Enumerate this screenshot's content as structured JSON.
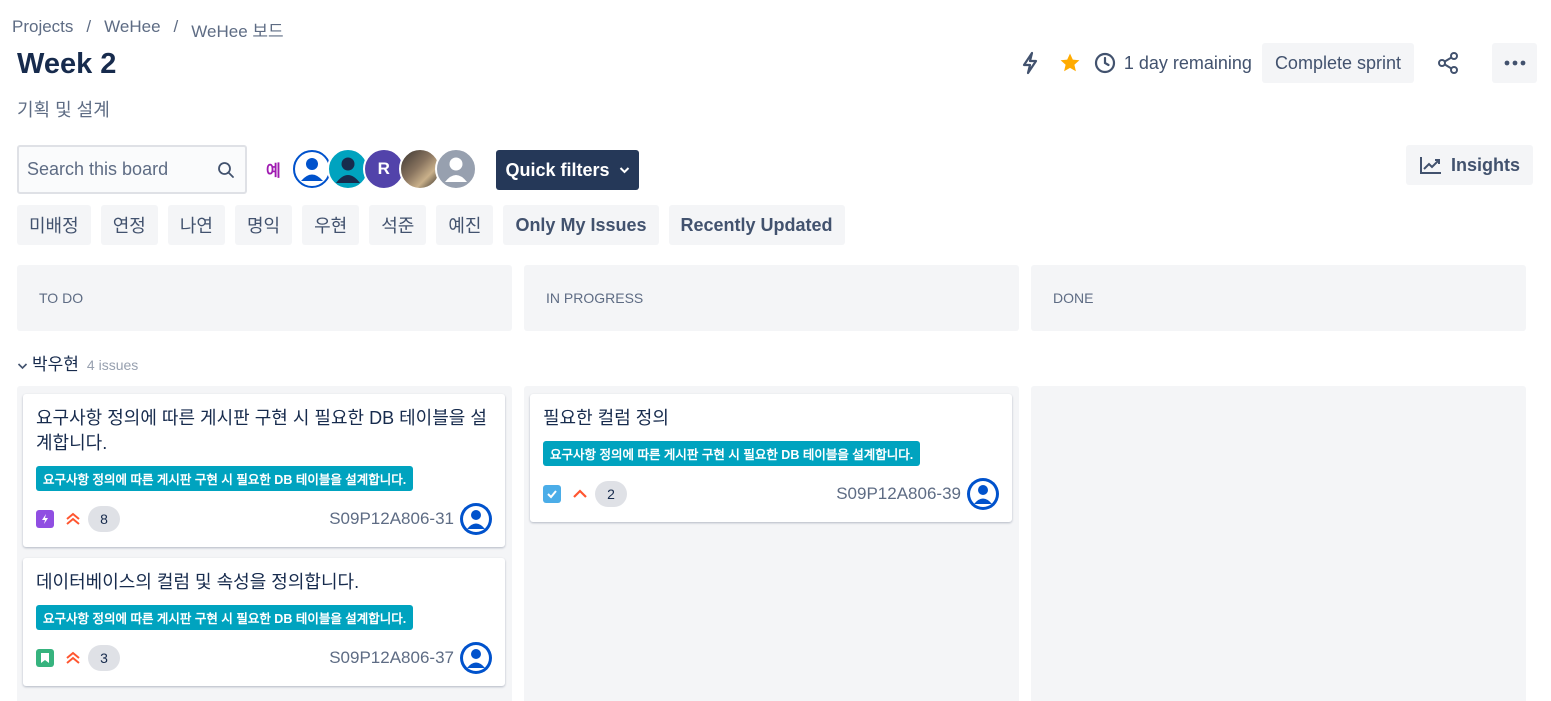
{
  "breadcrumb": [
    "Projects",
    "WeHee",
    "WeHee 보드"
  ],
  "sprint": {
    "title": "Week 2",
    "goal": "기획 및 설계",
    "remaining": "1 day remaining",
    "complete_label": "Complete sprint"
  },
  "search": {
    "placeholder": "Search this board"
  },
  "avatars": {
    "text_avatar": "예",
    "initial_avatar": "R"
  },
  "quick_filters_label": "Quick filters",
  "insights_label": "Insights",
  "filter_chips": [
    "미배정",
    "연정",
    "나연",
    "명익",
    "우현",
    "석준",
    "예진",
    "Only My Issues",
    "Recently Updated"
  ],
  "columns": [
    "TO DO",
    "IN PROGRESS",
    "DONE"
  ],
  "swimlane": {
    "name": "박우현",
    "count": "4 issues"
  },
  "cards": [
    {
      "title": "요구사항 정의에 따른 게시판 구현 시 필요한 DB 테이블을 설계합니다.",
      "epic": "요구사항 정의에 따른 게시판 구현 시 필요한 DB 테이블을 설계합니다.",
      "type": "subtask-icon",
      "priority": "highest-priority-icon",
      "points": "8",
      "key": "S09P12A806-31"
    },
    {
      "title": "데이터베이스의 컬럼 및 속성을 정의합니다.",
      "epic": "요구사항 정의에 따른 게시판 구현 시 필요한 DB 테이블을 설계합니다.",
      "type": "story-icon",
      "priority": "highest-priority-icon",
      "points": "3",
      "key": "S09P12A806-37"
    },
    {
      "title": "필요한 컬럼 정의",
      "epic": "요구사항 정의에 따른 게시판 구현 시 필요한 DB 테이블을 설계합니다.",
      "type": "task-icon",
      "priority": "high-priority-icon",
      "points": "2",
      "key": "S09P12A806-39"
    }
  ],
  "colors": {
    "epic": "#00a3bf",
    "quick_filters_bg": "#253858",
    "star": "#ffab00",
    "priority": "#ff5630",
    "story": "#36b37e",
    "subtask": "#904ee2",
    "task": "#4bade8"
  }
}
